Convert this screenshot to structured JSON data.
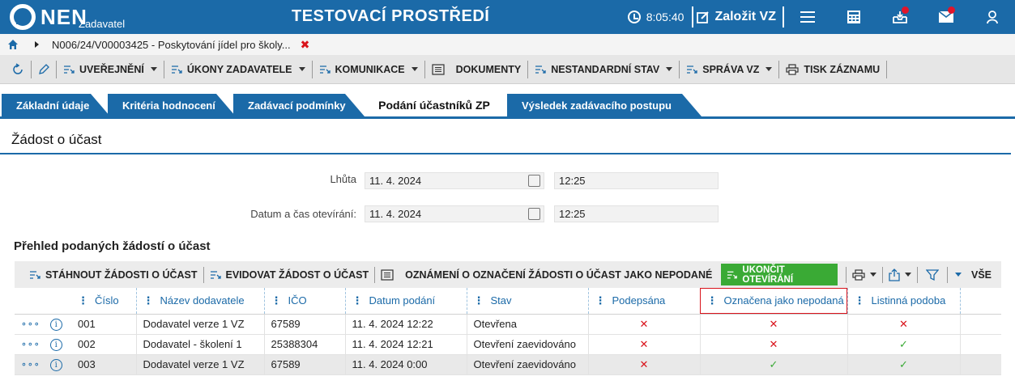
{
  "header": {
    "logo_text": "NEN",
    "logo_sub": "Zadavatel",
    "env_title": "TESTOVACÍ PROSTŘEDÍ",
    "time": "8:05:40",
    "create_label": "Založit VZ"
  },
  "breadcrumb": {
    "path": "N006/24/V00003425 - Poskytování jídel pro školy..."
  },
  "toolbar": {
    "publish": "UVEŘEJNĚNÍ",
    "actions": "ÚKONY ZADAVATELE",
    "communication": "KOMUNIKACE",
    "documents": "DOKUMENTY",
    "nonstandard": "NESTANDARDNÍ STAV",
    "management": "SPRÁVA VZ",
    "print": "TISK ZÁZNAMU"
  },
  "tabs": [
    {
      "label": "Základní údaje"
    },
    {
      "label": "Kritéria hodnocení"
    },
    {
      "label": "Zadávací podmínky"
    },
    {
      "label": "Podání účastníků ZP"
    },
    {
      "label": "Výsledek zadávacího postupu"
    }
  ],
  "section": {
    "title": "Žádost o účast",
    "deadline_label": "Lhůta",
    "deadline_date": "11. 4. 2024",
    "deadline_time": "12:25",
    "opening_label": "Datum a čas otevírání:",
    "opening_date": "11. 4. 2024",
    "opening_time": "12:25"
  },
  "overview": {
    "title": "Přehled podaných žádostí o účast",
    "download": "STÁHNOUT ŽÁDOSTI O ÚČAST",
    "register": "EVIDOVAT ŽÁDOST O ÚČAST",
    "notice": "OZNÁMENÍ O OZNAČENÍ ŽÁDOSTI O ÚČAST JAKO NEPODANÉ",
    "finish": "UKONČIT OTEVÍRÁNÍ",
    "all": "VŠE"
  },
  "table": {
    "columns": [
      "Číslo",
      "Název dodavatele",
      "IČO",
      "Datum podání",
      "Stav",
      "Podepsána",
      "Označena jako nepodaná",
      "Listinná podoba"
    ],
    "rows": [
      {
        "num": "001",
        "name": "Dodavatel verze 1 VZ",
        "ico": "67589",
        "date": "11. 4. 2024 12:22",
        "status": "Otevřena",
        "signed": "✕",
        "unsubmitted": "✕",
        "paper": "✕"
      },
      {
        "num": "002",
        "name": "Dodavatel - školení 1",
        "ico": "25388304",
        "date": "11. 4. 2024 12:21",
        "status": "Otevření zaevidováno",
        "signed": "✕",
        "unsubmitted": "✕",
        "paper": "✓"
      },
      {
        "num": "003",
        "name": "Dodavatel verze 1 VZ",
        "ico": "67589",
        "date": "11. 4. 2024 0:00",
        "status": "Otevření zaevidováno",
        "signed": "✕",
        "unsubmitted": "✓",
        "paper": "✓"
      }
    ]
  },
  "colors": {
    "primary": "#1b6aa8",
    "accent_red": "#d9141c",
    "green": "#3aaa35"
  }
}
